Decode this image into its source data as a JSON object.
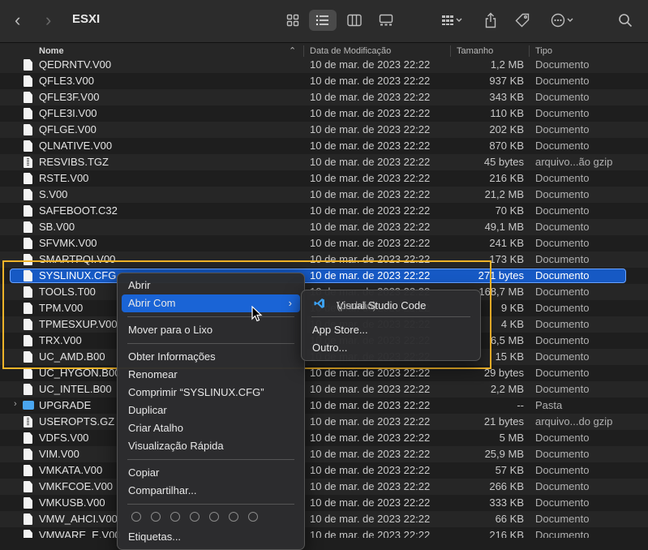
{
  "toolbar": {
    "title": "ESXI"
  },
  "columns": {
    "name": "Nome",
    "date": "Data de Modificação",
    "size": "Tamanho",
    "kind": "Tipo"
  },
  "rows": [
    {
      "name": "QEDRNTV.V00",
      "date": "10 de mar. de 2023 22:22",
      "size": "1,2 MB",
      "kind": "Documento"
    },
    {
      "name": "QFLE3.V00",
      "date": "10 de mar. de 2023 22:22",
      "size": "937 KB",
      "kind": "Documento"
    },
    {
      "name": "QFLE3F.V00",
      "date": "10 de mar. de 2023 22:22",
      "size": "343 KB",
      "kind": "Documento"
    },
    {
      "name": "QFLE3I.V00",
      "date": "10 de mar. de 2023 22:22",
      "size": "110 KB",
      "kind": "Documento"
    },
    {
      "name": "QFLGE.V00",
      "date": "10 de mar. de 2023 22:22",
      "size": "202 KB",
      "kind": "Documento"
    },
    {
      "name": "QLNATIVE.V00",
      "date": "10 de mar. de 2023 22:22",
      "size": "870 KB",
      "kind": "Documento"
    },
    {
      "name": "RESVIBS.TGZ",
      "date": "10 de mar. de 2023 22:22",
      "size": "45 bytes",
      "kind": "arquivo...ão gzip"
    },
    {
      "name": "RSTE.V00",
      "date": "10 de mar. de 2023 22:22",
      "size": "216 KB",
      "kind": "Documento"
    },
    {
      "name": "S.V00",
      "date": "10 de mar. de 2023 22:22",
      "size": "21,2 MB",
      "kind": "Documento"
    },
    {
      "name": "SAFEBOOT.C32",
      "date": "10 de mar. de 2023 22:22",
      "size": "70 KB",
      "kind": "Documento"
    },
    {
      "name": "SB.V00",
      "date": "10 de mar. de 2023 22:22",
      "size": "49,1 MB",
      "kind": "Documento"
    },
    {
      "name": "SFVMK.V00",
      "date": "10 de mar. de 2023 22:22",
      "size": "241 KB",
      "kind": "Documento"
    },
    {
      "name": "SMARTPQI.V00",
      "date": "10 de mar. de 2023 22:22",
      "size": "173 KB",
      "kind": "Documento"
    },
    {
      "name": "SYSLINUX.CFG",
      "date": "10 de mar. de 2023 22:22",
      "size": "271 bytes",
      "kind": "Documento"
    },
    {
      "name": "TOOLS.T00",
      "date": "10 de mar. de 2023 22:22",
      "size": "168,7 MB",
      "kind": "Documento"
    },
    {
      "name": "TPM.V00",
      "date": "10 de mar. de 2023 22:22",
      "size": "9 KB",
      "kind": "Documento"
    },
    {
      "name": "TPMESXUP.V00",
      "date": "10 de mar. de 2023 22:22",
      "size": "4 KB",
      "kind": "Documento"
    },
    {
      "name": "TRX.V00",
      "date": "10 de mar. de 2023 22:22",
      "size": "6,5 MB",
      "kind": "Documento"
    },
    {
      "name": "UC_AMD.B00",
      "date": "10 de mar. de 2023 22:22",
      "size": "15 KB",
      "kind": "Documento"
    },
    {
      "name": "UC_HYGON.B00",
      "date": "10 de mar. de 2023 22:22",
      "size": "29 bytes",
      "kind": "Documento"
    },
    {
      "name": "UC_INTEL.B00",
      "date": "10 de mar. de 2023 22:22",
      "size": "2,2 MB",
      "kind": "Documento"
    },
    {
      "name": "UPGRADE",
      "date": "10 de mar. de 2023 22:22",
      "size": "--",
      "kind": "Pasta"
    },
    {
      "name": "USEROPTS.GZ",
      "date": "10 de mar. de 2023 22:22",
      "size": "21 bytes",
      "kind": "arquivo...do gzip"
    },
    {
      "name": "VDFS.V00",
      "date": "10 de mar. de 2023 22:22",
      "size": "5 MB",
      "kind": "Documento"
    },
    {
      "name": "VIM.V00",
      "date": "10 de mar. de 2023 22:22",
      "size": "25,9 MB",
      "kind": "Documento"
    },
    {
      "name": "VMKATA.V00",
      "date": "10 de mar. de 2023 22:22",
      "size": "57 KB",
      "kind": "Documento"
    },
    {
      "name": "VMKFCOE.V00",
      "date": "10 de mar. de 2023 22:22",
      "size": "266 KB",
      "kind": "Documento"
    },
    {
      "name": "VMKUSB.V00",
      "date": "10 de mar. de 2023 22:22",
      "size": "333 KB",
      "kind": "Documento"
    },
    {
      "name": "VMW_AHCI.V00",
      "date": "10 de mar. de 2023 22:22",
      "size": "66 KB",
      "kind": "Documento"
    },
    {
      "name": "VMWARE_E.V00",
      "date": "10 de mar. de 2023 22:22",
      "size": "216 KB",
      "kind": "Documento"
    }
  ],
  "context_menu": {
    "open": "Abrir",
    "open_with": "Abrir Com",
    "move_to_trash": "Mover para o Lixo",
    "get_info": "Obter Informações",
    "rename": "Renomear",
    "compress": "Comprimir “SYSLINUX.CFG”",
    "duplicate": "Duplicar",
    "make_alias": "Criar Atalho",
    "quick_look": "Visualização Rápida",
    "copy": "Copiar",
    "share": "Compartilhar...",
    "tags": "Etiquetas..."
  },
  "submenu": {
    "vscode": "Visual Studio Code",
    "vscode_default": "(padrão)",
    "app_store": "App Store...",
    "other": "Outro..."
  }
}
